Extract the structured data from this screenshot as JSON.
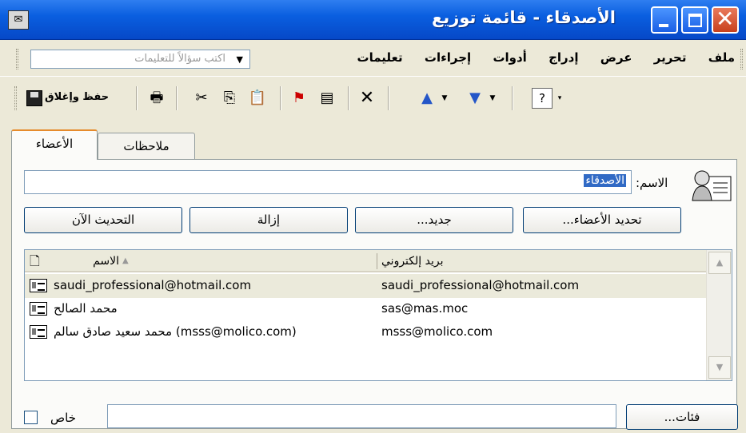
{
  "window": {
    "title": "الأصدقاء - قائمة توزيع",
    "app_icon": "distribution-list-icon"
  },
  "menu": {
    "items": [
      "ملف",
      "تحرير",
      "عرض",
      "إدراج",
      "أدوات",
      "إجراءات",
      "تعليمات"
    ],
    "help_placeholder": "اكتب سؤالاً للتعليمات"
  },
  "toolbar": {
    "save_close_label": "حفظ وإغلاق",
    "icons": [
      "save-close-icon",
      "print-icon",
      "cut-icon",
      "copy-icon",
      "paste-icon",
      "flag-icon",
      "insert-file-icon",
      "delete-icon",
      "previous-item-icon",
      "next-item-icon",
      "help-icon"
    ]
  },
  "tabs": [
    {
      "label": "الأعضاء",
      "active": true
    },
    {
      "label": "ملاحظات",
      "active": false
    }
  ],
  "form": {
    "name_label": "الاسم:",
    "name_value": "الأصدقاء"
  },
  "buttons": {
    "select_members": "تحديد الأعضاء...",
    "add_new": "جديد...",
    "remove": "إزالة",
    "update_now": "التحديث الآن"
  },
  "members_list": {
    "columns": {
      "name": "الاسم",
      "email": "بريد إلكتروني"
    },
    "rows": [
      {
        "name": "saudi_professional@hotmail.com",
        "email": "saudi_professional@hotmail.com",
        "selected": true
      },
      {
        "name": "محمد الصالح",
        "email": "sas@mas.moc",
        "selected": false
      },
      {
        "name": "محمد سعيد صادق سالم (msss@molico.com)",
        "email": "msss@molico.com",
        "selected": false
      }
    ]
  },
  "bottom": {
    "categories_label": "فئات...",
    "private_label": "خاص",
    "private_checked": false
  }
}
